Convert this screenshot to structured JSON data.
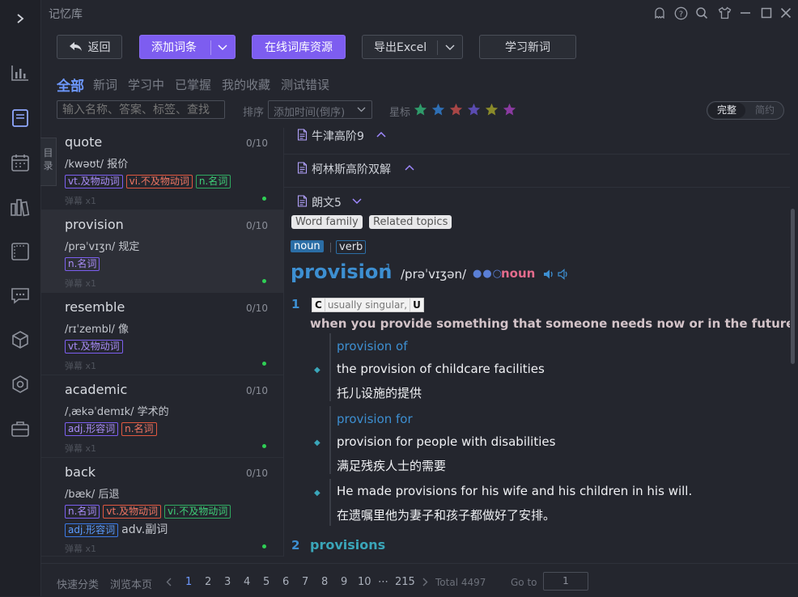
{
  "app": {
    "title": "记忆库"
  },
  "toolbar": {
    "back_label": "返回",
    "add_entry_label": "添加词条",
    "online_label": "在线词库资源",
    "export_label": "导出Excel",
    "learn_label": "学习新词"
  },
  "filters": [
    "全部",
    "新词",
    "学习中",
    "已掌握",
    "我的收藏",
    "测试错误"
  ],
  "search": {
    "placeholder": "输入名称、答案、标签、查找"
  },
  "sort": {
    "label": "排序",
    "value": "添加时间(倒序)"
  },
  "star": {
    "label": "星标",
    "colors": [
      "#2f9a6a",
      "#2e6fb5",
      "#a84646",
      "#5a4bb0",
      "#8a8a2a",
      "#8a3aa0"
    ]
  },
  "view_toggle": {
    "full": "完整",
    "brief": "简约"
  },
  "toc_label": "目录",
  "words": [
    {
      "word": "quote",
      "count": "0/10",
      "phonetic": "/kwəʊt/",
      "meaning": "报价",
      "tags": [
        {
          "text": "vt.及物动词",
          "color": "purple"
        },
        {
          "text": "vi.不及物动词",
          "color": "red"
        },
        {
          "text": "n.名词",
          "color": "green"
        }
      ],
      "extra": "",
      "danmu": "弹幕 x1"
    },
    {
      "word": "provision",
      "count": "0/10",
      "phonetic": "/prəˈvɪʒn/",
      "meaning": "规定",
      "tags": [
        {
          "text": "n.名词",
          "color": "purple"
        }
      ],
      "extra": "",
      "danmu": "弹幕 x1"
    },
    {
      "word": "resemble",
      "count": "0/10",
      "phonetic": "/rɪˈzembl/",
      "meaning": "像",
      "tags": [
        {
          "text": "vt.及物动词",
          "color": "purple"
        }
      ],
      "extra": "",
      "danmu": "弹幕 x1"
    },
    {
      "word": "academic",
      "count": "0/10",
      "phonetic": "/ˌækəˈdemɪk/",
      "meaning": "学术的",
      "tags": [
        {
          "text": "adj.形容词",
          "color": "purple"
        },
        {
          "text": "n.名词",
          "color": "red"
        }
      ],
      "extra": "",
      "danmu": "弹幕 x1"
    },
    {
      "word": "back",
      "count": "0/10",
      "phonetic": "/bæk/",
      "meaning": "后退",
      "tags": [
        {
          "text": "n.名词",
          "color": "purple"
        },
        {
          "text": "vt.及物动词",
          "color": "red"
        },
        {
          "text": "vi.不及物动词",
          "color": "green"
        },
        {
          "text": "adj.形容词",
          "color": "blue"
        }
      ],
      "extra": "adv.副词",
      "danmu": "弹幕 x1"
    }
  ],
  "dicts": [
    {
      "name": "牛津高阶9",
      "expanded": true
    },
    {
      "name": "柯林斯高阶双解",
      "expanded": true
    },
    {
      "name": "朗文5",
      "expanded": false
    }
  ],
  "entry": {
    "word_family": "Word family",
    "related_topics": "Related topics",
    "pos_noun": "noun",
    "pos_verb": "verb",
    "headword": "provision",
    "homnum": "1",
    "pron": "/prəˈvɪʒən/",
    "freq": "●●○",
    "pos": "noun",
    "sense1_num": "1",
    "gram_c": "C",
    "gram_text": "usually singular,",
    "gram_u": "U",
    "def1": "when you provide something that someone needs now or in the future",
    "ex_groups": [
      {
        "colloc": "provision of",
        "en": "the provision of childcare facilities",
        "zh": "托儿设施的提供"
      },
      {
        "colloc": "provision for",
        "en": "provision for people with disabilities",
        "zh": "满足残疾人士的需要"
      },
      {
        "colloc": "",
        "en": "He made provisions for his wife and his children in his will.",
        "zh": "在遗嘱里他为妻子和孩子都做好了安排。"
      }
    ],
    "sense2_num": "2",
    "sense2_head": "provisions"
  },
  "footer": {
    "quick_classify": "快速分类",
    "browse_page": "浏览本页",
    "pages": [
      "1",
      "2",
      "3",
      "4",
      "5",
      "6",
      "7",
      "8",
      "9",
      "10"
    ],
    "ellipsis": "⋯",
    "last_page": "215",
    "total": "Total 4497",
    "goto_label": "Go to",
    "goto_value": "1"
  }
}
